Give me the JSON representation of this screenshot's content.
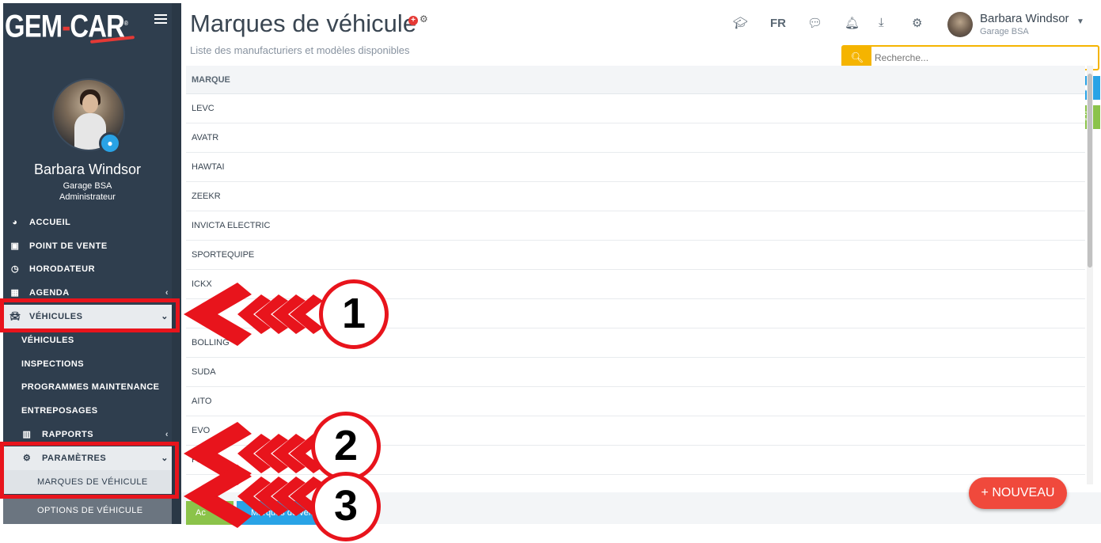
{
  "brand": {
    "logo_text_1": "GEM",
    "logo_dash": "-",
    "logo_text_2": "CAR",
    "reg": "®",
    "accent": "#e53935"
  },
  "sidebar": {
    "bg_color": "#2f3e4e",
    "profile": {
      "name": "Barbara Windsor",
      "garage": "Garage BSA",
      "role": "Administrateur"
    },
    "menu": [
      {
        "label": "ACCUEIL",
        "icon": "dashboard-icon"
      },
      {
        "label": "POINT DE VENTE",
        "icon": "cash-icon"
      },
      {
        "label": "HORODATEUR",
        "icon": "clock-icon"
      },
      {
        "label": "AGENDA",
        "icon": "calendar-icon"
      },
      {
        "label": "VÉHICULES",
        "icon": "car-icon"
      }
    ],
    "vehicules_sub": [
      "VÉHICULES",
      "INSPECTIONS",
      "PROGRAMMES MAINTENANCE",
      "ENTREPOSAGES"
    ],
    "rapports": {
      "label": "RAPPORTS",
      "icon": "bar-chart-icon"
    },
    "parametres": {
      "label": "PARAMÈTRES",
      "icon": "gear-icon"
    },
    "parametres_sub": [
      "MARQUES DE VÉHICULE",
      "OPTIONS DE VÉHICULE"
    ]
  },
  "header": {
    "title": "Marques de véhicule",
    "subtitle": "Liste des manufacturiers et modèles disponibles",
    "lang": "FR",
    "user": {
      "name": "Barbara Windsor",
      "garage": "Garage BSA"
    },
    "search_placeholder": "Recherche...",
    "search_color": "#f5b400"
  },
  "table": {
    "header": "MARQUE",
    "rows": [
      "LEVC",
      "AVATR",
      "HAWTAI",
      "ZEEKR",
      "INVICTA ELECTRIC",
      "SPORTEQUIPE",
      "ICKX",
      "",
      "BOLLING",
      "SUDA",
      "AITO",
      "EVO",
      "FI"
    ]
  },
  "footer": {
    "btn_green": "Ac",
    "btn_blue": "Marques de véh",
    "new_button": "+ NOUVEAU",
    "new_color": "#f0493c"
  },
  "annotations": {
    "color": "#e8141c",
    "steps": [
      "1",
      "2",
      "3"
    ]
  }
}
